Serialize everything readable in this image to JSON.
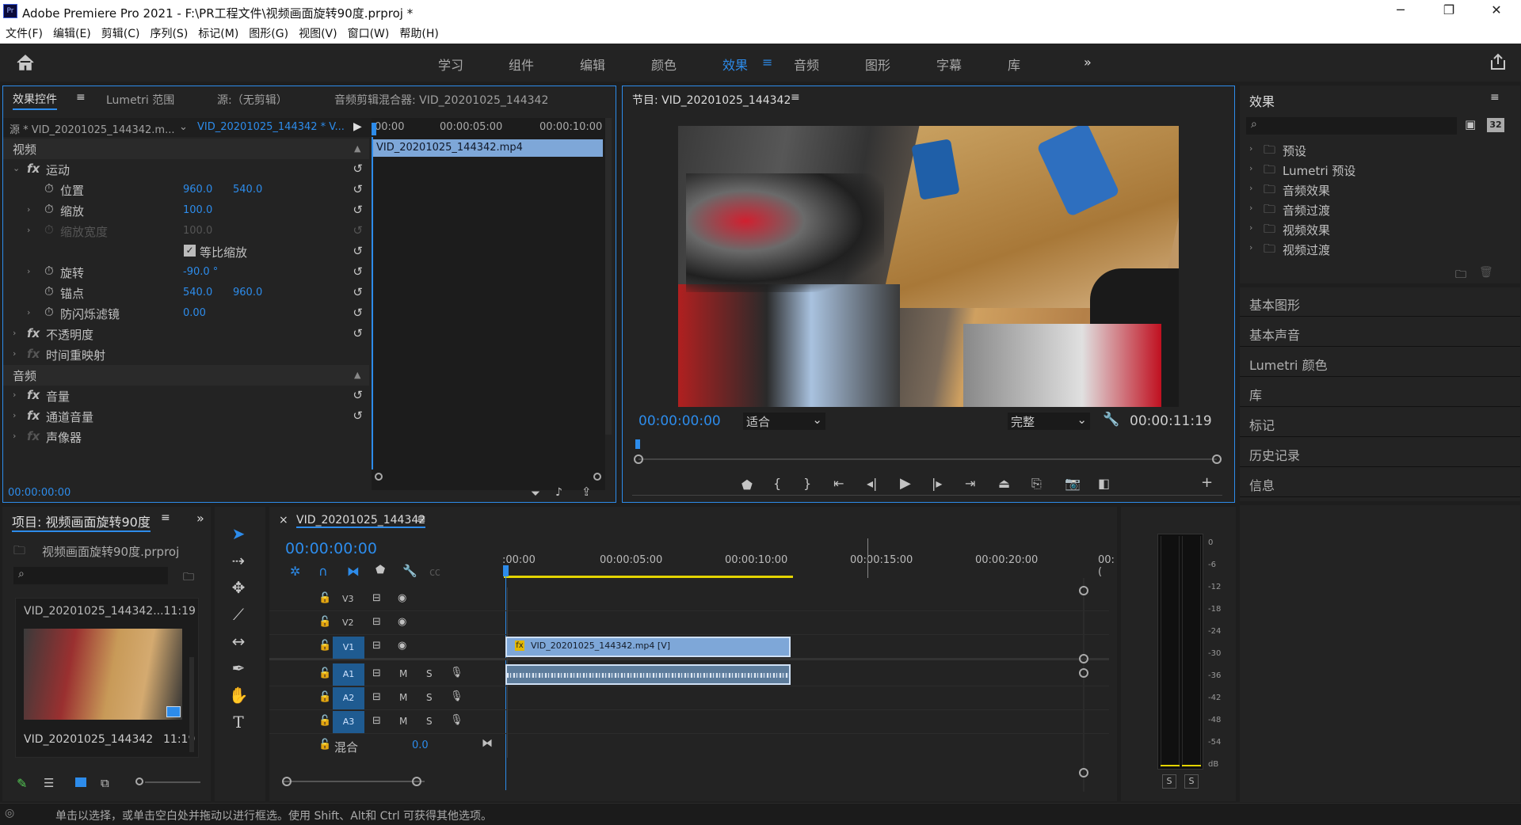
{
  "app": {
    "title": "Adobe Premiere Pro 2021 - F:\\PR工程文件\\视频画面旋转90度.prproj *",
    "icon": "Pr"
  },
  "window_controls": {
    "minimize": "─",
    "maximize": "❐",
    "close": "✕"
  },
  "menu": [
    "文件(F)",
    "编辑(E)",
    "剪辑(C)",
    "序列(S)",
    "标记(M)",
    "图形(G)",
    "视图(V)",
    "窗口(W)",
    "帮助(H)"
  ],
  "workspaces": {
    "items": [
      "学习",
      "组件",
      "编辑",
      "颜色",
      "效果",
      "音频",
      "图形",
      "字幕",
      "库"
    ],
    "active": "效果",
    "more": "»"
  },
  "effect_controls": {
    "tabs": [
      "效果控件",
      "Lumetri 范围",
      "源:（无剪辑）",
      "音频剪辑混合器: VID_20201025_144342"
    ],
    "source_label": "源 * VID_20201025_144342.m...",
    "sequence_label": "VID_20201025_144342 * V...",
    "ruler": [
      "00:00",
      "00:00:05:00",
      "00:00:10:00"
    ],
    "clip_name": "VID_20201025_144342.mp4",
    "video_header": "视频",
    "audio_header": "音频",
    "motion": "运动",
    "position": "位置",
    "position_x": "960.0",
    "position_y": "540.0",
    "scale": "缩放",
    "scale_val": "100.0",
    "scale_width": "缩放宽度",
    "scale_width_val": "100.0",
    "uniform_scale": "等比缩放",
    "rotation": "旋转",
    "rotation_val": "-90.0 °",
    "anchor": "锚点",
    "anchor_x": "540.0",
    "anchor_y": "960.0",
    "anti_flicker": "防闪烁滤镜",
    "anti_flicker_val": "0.00",
    "opacity": "不透明度",
    "time_remap": "时间重映射",
    "volume": "音量",
    "channel_volume": "通道音量",
    "panner": "声像器",
    "timecode": "00:00:00:00"
  },
  "program": {
    "title": "节目: VID_20201025_144342",
    "timecode": "00:00:00:00",
    "fit": "适合",
    "quality": "完整",
    "duration": "00:00:11:19"
  },
  "effects_panel": {
    "title": "效果",
    "search_placeholder": "",
    "items": [
      "预设",
      "Lumetri 预设",
      "音频效果",
      "音频过渡",
      "视频效果",
      "视频过渡"
    ],
    "side_panels": [
      "基本图形",
      "基本声音",
      "Lumetri 颜色",
      "库",
      "标记",
      "历史记录",
      "信息"
    ]
  },
  "project": {
    "title": "项目: 视频画面旋转90度",
    "file": "视频画面旋转90度.prproj",
    "item_top": "VID_20201025_144342...11:19",
    "item_name": "VID_20201025_144342",
    "item_dur": "11:19"
  },
  "timeline": {
    "tab": "VID_20201025_144342",
    "timecode": "00:00:00:00",
    "ruler": [
      ":00:00",
      "00:00:05:00",
      "00:00:10:00",
      "00:00:15:00",
      "00:00:20:00",
      "00:("
    ],
    "tracks": [
      "V3",
      "V2",
      "V1",
      "A1",
      "A2",
      "A3"
    ],
    "mix": "混合",
    "mix_val": "0.0",
    "clip_video": "VID_20201025_144342.mp4 [V]",
    "mute": "M",
    "solo": "S",
    "fx": "fx"
  },
  "meter": {
    "labels": [
      "0",
      "-6",
      "-12",
      "-18",
      "-24",
      "-30",
      "-36",
      "-42",
      "-48",
      "-54",
      "dB"
    ],
    "solo": "S"
  },
  "status": {
    "text": "单击以选择，或单击空白处并拖动以进行框选。使用 Shift、Alt和 Ctrl 可获得其他选项。"
  },
  "colors": {
    "accent": "#2d8ceb",
    "panel": "#232323",
    "bg": "#1e1e1e",
    "clip": "#7ea7d8",
    "work_area": "#e3d400"
  }
}
